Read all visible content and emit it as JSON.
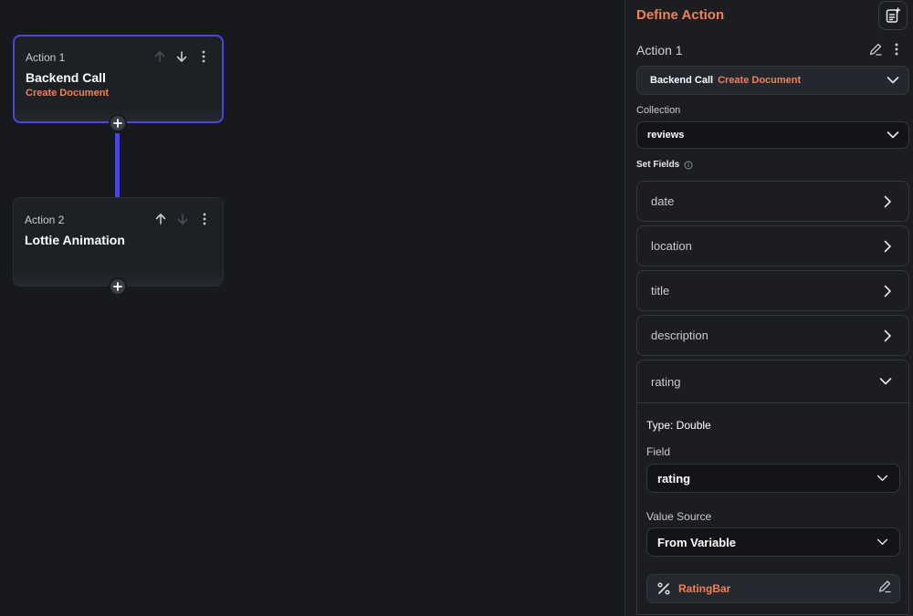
{
  "canvas": {
    "actions": [
      {
        "label": "Action 1",
        "title": "Backend Call",
        "subtitle": "Create Document"
      },
      {
        "label": "Action 2",
        "title": "Lottie Animation",
        "subtitle": ""
      }
    ]
  },
  "panel": {
    "title": "Define Action",
    "action_name": "Action 1",
    "action_type": {
      "primary": "Backend Call",
      "secondary": "Create Document"
    },
    "collection_label": "Collection",
    "collection_value": "reviews",
    "set_fields_label": "Set Fields",
    "fields": [
      "date",
      "location",
      "title",
      "description"
    ],
    "expanded_field": {
      "name": "rating",
      "type_text": "Type: Double",
      "field_label": "Field",
      "field_value": "rating",
      "value_source_label": "Value Source",
      "value_source_value": "From Variable",
      "variable_name": "RatingBar"
    }
  },
  "colors": {
    "accent": "#ef8158",
    "selection": "#4b45e4",
    "background": "#17191d"
  }
}
